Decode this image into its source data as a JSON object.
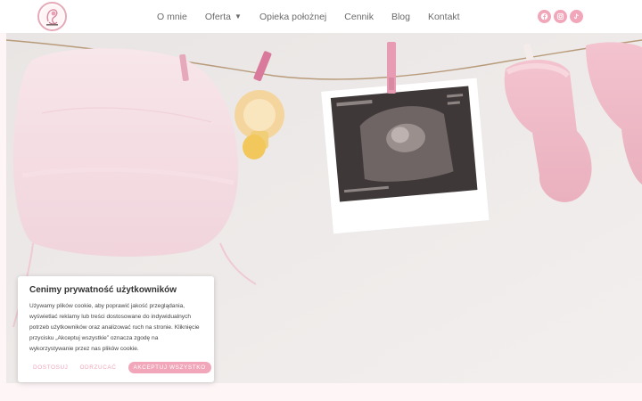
{
  "nav": {
    "items": [
      {
        "label": "O mnie"
      },
      {
        "label": "Oferta",
        "has_dropdown": true
      },
      {
        "label": "Opieka położnej"
      },
      {
        "label": "Cennik"
      },
      {
        "label": "Blog"
      },
      {
        "label": "Kontakt"
      }
    ]
  },
  "social": {
    "icons": [
      "facebook-icon",
      "instagram-icon",
      "tiktok-icon"
    ],
    "color": "#f1a6b9"
  },
  "hero": {
    "image": "baby-items-clothesline-photo"
  },
  "cookie": {
    "title": "Cenimy prywatność użytkowników",
    "text": "Używamy plików cookie, aby poprawić jakość przeglądania, wyświetlać reklamy lub treści dostosowane do indywidualnych potrzeb użytkowników oraz analizować ruch na stronie. Kliknięcie przycisku „Akceptuj wszystkie” oznacza zgodę na wykorzystywanie przez nas plików cookie.",
    "customize_label": "DOSTOSUJ",
    "reject_label": "ODRZUCAĆ",
    "accept_label": "AKCEPTUJ WSZYSTKO"
  },
  "colors": {
    "accent": "#f1a6b9",
    "background": "#fdf5f6"
  }
}
